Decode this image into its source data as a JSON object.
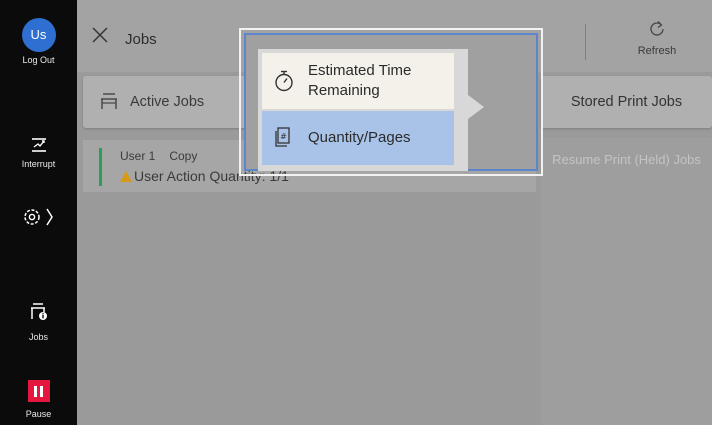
{
  "sidebar": {
    "avatar_initials": "Us",
    "logout_label": "Log Out",
    "interrupt_label": "Interrupt",
    "jobs_label": "Jobs",
    "pause_label": "Pause"
  },
  "header": {
    "title": "Jobs",
    "refresh_label": "Refresh"
  },
  "tabs": {
    "active_jobs": "Active Jobs",
    "stored_print_jobs": "Stored Print Jobs"
  },
  "job": {
    "user": "User 1",
    "type": "Copy",
    "status": "User Action",
    "quantity": "Quantity: 1/1"
  },
  "right_panel": {
    "resume_label": "Resume Print (Held) Jobs"
  },
  "popup_menu": {
    "items": [
      {
        "label": "Estimated Time Remaining",
        "icon": "stopwatch-icon",
        "selected": false
      },
      {
        "label": "Quantity/Pages",
        "icon": "document-hash-icon",
        "selected": true
      }
    ]
  },
  "colors": {
    "sidebar_bg": "#0b0b0b",
    "avatar_blue": "#2f6fd1",
    "pause_red": "#e5173f",
    "selected_item": "#a9c3e8",
    "popup_border": "#5c86c9",
    "status_green": "#2a9d5a",
    "warning_amber": "#d89a16"
  }
}
